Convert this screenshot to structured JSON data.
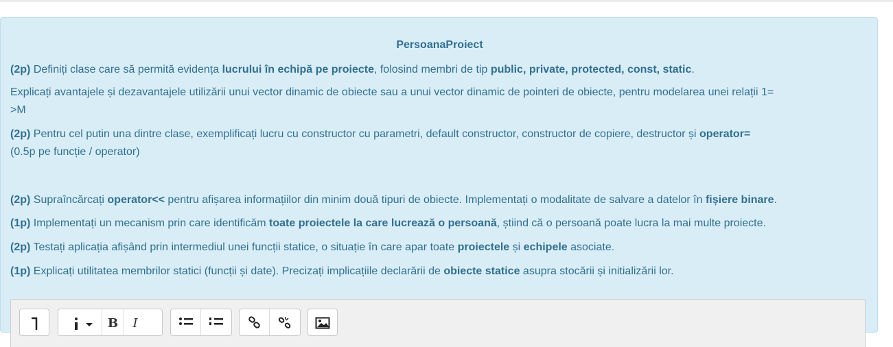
{
  "title": "PersoanaProiect",
  "items": [
    {
      "pts": "(2p)",
      "t1": " Definiți clase care să permită evidența ",
      "b1": "lucrului în echipă pe proiecte",
      "t2": ", folosind membri de tip ",
      "b2": "public, private,  protected, const, static",
      "t3": "."
    },
    {
      "line1": "Explicați avantajele și dezavantajele utilizării unui vector dinamic de obiecte sau a unui vector dinamic de pointeri de obiecte, pentru modelarea unei relații  1=",
      "line2": ">M"
    },
    {
      "pts": "(2p)",
      "t1": " Pentru cel putin una dintre clase, exemplificați lucru cu constructor cu parametri, default constructor, constructor de copiere, destructor și ",
      "b1": "operator=",
      "line2": "(0.5p pe funcție / operator)"
    },
    {
      "pts": "(2p)",
      "t1": " Supraîncărcați ",
      "b1": "operator<<",
      "t2": " pentru afișarea informațiilor din minim două tipuri de obiecte. Implementați o modalitate de salvare a datelor în ",
      "b2": "fișiere binare",
      "t3": "."
    },
    {
      "pts": "(1p)",
      "t1": " Implementați un mecanism prin care identificăm ",
      "b1": "toate proiectele la care lucrează o persoană",
      "t2": ", știind că o persoană poate lucra la mai multe proiecte."
    },
    {
      "pts": "(2p)",
      "t1": " Testați aplicația afișând  prin intermediul unei funcții statice, o situație în care apar toate ",
      "b1": "proiectele",
      "t2": " și ",
      "b2": "echipele",
      "t3": " asociate."
    },
    {
      "pts": "(1p)",
      "t1": " Explicați utilitatea membrilor statici (funcții și date). Precizați implicațiile declarării de ",
      "b1": "obiecte statice",
      "t2": " asupra stocării și initializării lor."
    }
  ],
  "toolbar": {
    "paragraph_icon": "paragraph-format-icon",
    "info_icon": "info-dropdown-icon",
    "bold_label": "B",
    "italic_label": "I",
    "bullet_icon": "bullet-list-icon",
    "numbered_icon": "numbered-list-icon",
    "link_icon": "link-icon",
    "unlink_icon": "unlink-icon",
    "image_icon": "image-icon"
  },
  "colors": {
    "panel_bg": "#d9edf7",
    "text": "#31708f",
    "border": "#bcdff1"
  }
}
